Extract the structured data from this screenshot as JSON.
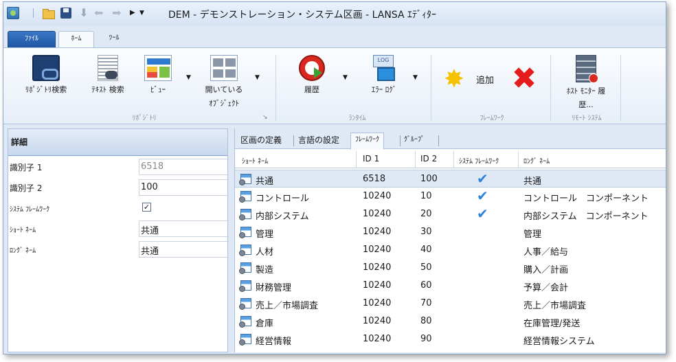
{
  "window": {
    "title": "DEM - デモンストレーション・システム区画 - LANSA ｴﾃﾞｨﾀｰ"
  },
  "ribbon_tabs": {
    "file": "ﾌｧｲﾙ",
    "home": "ﾎｰﾑ",
    "tools": "ﾂｰﾙ"
  },
  "ribbon": {
    "repo_search": "ﾘﾎﾟｼﾞﾄﾘ検索",
    "text_search": "ﾃｷｽﾄ 検索",
    "view": "ﾋﾞｭｰ",
    "open_objects_1": "開いている",
    "open_objects_2": "ｵﾌﾞｼﾞｪｸﾄ",
    "group_repository": "ﾘﾎﾟｼﾞﾄﾘ",
    "history": "履歴",
    "error_log": "ｴﾗｰ ﾛｸﾞ",
    "group_runtime": "ﾗﾝﾀｲﾑ",
    "add": "追加",
    "group_framework": "ﾌﾚｰﾑﾜｰｸ",
    "host_monitor_1": "ﾎｽﾄ ﾓﾆﾀｰ 履",
    "host_monitor_2": "歴...",
    "group_remote": "ﾘﾓｰﾄ ｼｽﾃﾑ"
  },
  "details": {
    "header": "詳細",
    "id1_label": "識別子 1",
    "id1_value": "6518",
    "id2_label": "識別子 2",
    "id2_value": "100",
    "sysfw_label": "ｼｽﾃﾑ ﾌﾚｰﾑﾜｰｸ",
    "sysfw_checked": "✓",
    "short_label": "ｼｮｰﾄ ﾈｰﾑ",
    "short_value": "共通",
    "long_label": "ﾛﾝｸﾞ ﾈｰﾑ",
    "long_value": "共通"
  },
  "inner_tabs": {
    "definition": "区画の定義",
    "language": "言語の設定",
    "framework": "ﾌﾚｰﾑﾜｰｸ",
    "group": "ｸﾞﾙｰﾌﾟ"
  },
  "grid": {
    "columns": {
      "short_name": "ｼｮｰﾄ ﾈｰﾑ",
      "id1": "ID 1",
      "id2": "ID 2",
      "system_framework": "ｼｽﾃﾑ ﾌﾚｰﾑﾜｰｸ",
      "long_name": "ﾛﾝｸﾞ ﾈｰﾑ"
    },
    "rows": [
      {
        "short": "共通",
        "id1": "6518",
        "id2": "100",
        "sys": true,
        "long": "共通"
      },
      {
        "short": "コントロール",
        "id1": "10240",
        "id2": "10",
        "sys": true,
        "long": "コントロール　コンポーネント"
      },
      {
        "short": "内部システム",
        "id1": "10240",
        "id2": "20",
        "sys": true,
        "long": "内部システム　コンポーネント"
      },
      {
        "short": "管理",
        "id1": "10240",
        "id2": "30",
        "sys": false,
        "long": "管理"
      },
      {
        "short": "人材",
        "id1": "10240",
        "id2": "40",
        "sys": false,
        "long": "人事／給与"
      },
      {
        "short": "製造",
        "id1": "10240",
        "id2": "50",
        "sys": false,
        "long": "購入／計画"
      },
      {
        "short": "財務管理",
        "id1": "10240",
        "id2": "60",
        "sys": false,
        "long": "予算／会計"
      },
      {
        "short": "売上／市場調査",
        "id1": "10240",
        "id2": "70",
        "sys": false,
        "long": "売上／市場調査"
      },
      {
        "short": "倉庫",
        "id1": "10240",
        "id2": "80",
        "sys": false,
        "long": "在庫管理/発送"
      },
      {
        "short": "経営情報",
        "id1": "10240",
        "id2": "90",
        "sys": false,
        "long": "経営情報システム"
      }
    ]
  },
  "colors": {
    "accent": "#1f56a3",
    "selection": "#dfe9f6",
    "check": "#2e82d9",
    "delete": "#e51c1c"
  }
}
